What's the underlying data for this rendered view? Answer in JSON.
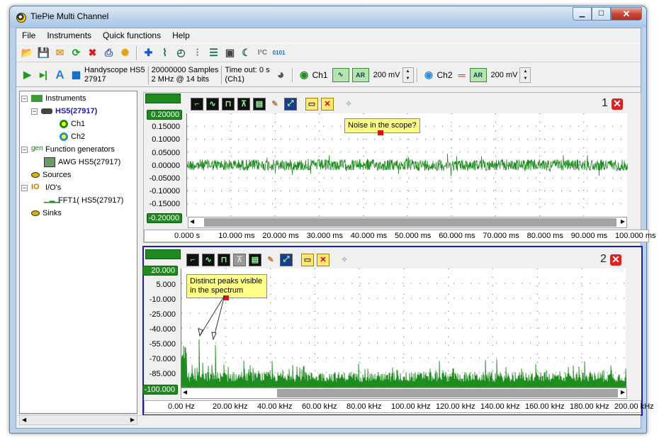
{
  "window": {
    "title": "TiePie Multi Channel"
  },
  "menu": [
    "File",
    "Instruments",
    "Quick functions",
    "Help"
  ],
  "toolbar": {
    "device_name": "Handyscope HS5",
    "device_serial": "27917",
    "samples": "20000000 Samples",
    "resolution": "2 MHz @ 14 bits",
    "timeout": "Time out: 0 s",
    "timeout_ch": "(Ch1)",
    "ch1_label": "Ch1",
    "ch1_coupling": "AR",
    "ch1_range": "200 mV",
    "ch2_label": "Ch2",
    "ch2_coupling": "AR",
    "ch2_range": "200 mV"
  },
  "tree": {
    "instruments": "Instruments",
    "hs5": "HS5(27917)",
    "ch1": "Ch1",
    "ch2": "Ch2",
    "function_generators": "Function generators",
    "awg": "AWG HS5(27917)",
    "sources": "Sources",
    "ios": "I/O's",
    "fft": "FFT1( HS5(27917)",
    "sinks": "Sinks"
  },
  "scope": {
    "number": "1",
    "y_labels": [
      "0.20000",
      "0.15000",
      "0.10000",
      "0.05000",
      "0.00000",
      "-0.05000",
      "-0.10000",
      "-0.15000",
      "-0.20000"
    ],
    "x_labels": [
      "0.000 s",
      "10.000 ms",
      "20.000 ms",
      "30.000 ms",
      "40.000 ms",
      "50.000 ms",
      "60.000 ms",
      "70.000 ms",
      "80.000 ms",
      "90.000 ms",
      "100.000 ms"
    ],
    "note": "Noise in the scope?",
    "trace_color": "#1e8c1e"
  },
  "spectrum": {
    "number": "2",
    "y_labels": [
      "20.000",
      "5.000",
      "-10.000",
      "-25.000",
      "-40.000",
      "-55.000",
      "-70.000",
      "-85.000",
      "-100.000"
    ],
    "x_labels": [
      "0.00 Hz",
      "20.00 kHz",
      "40.00 kHz",
      "60.00 kHz",
      "80.00 kHz",
      "100.00 kHz",
      "120.00 kHz",
      "140.00 kHz",
      "160.00 kHz",
      "180.00 kHz",
      "200.00 kHz"
    ],
    "note_line1": "Distinct peaks visible",
    "note_line2": "in the spectrum",
    "trace_color": "#1e8c1e"
  },
  "icons": [
    "open-icon",
    "save-icon",
    "mail-icon",
    "refresh-icon",
    "delete-icon",
    "print-icon",
    "settings-icon",
    "start-icon",
    "single-icon",
    "auto-icon",
    "close-icon"
  ]
}
